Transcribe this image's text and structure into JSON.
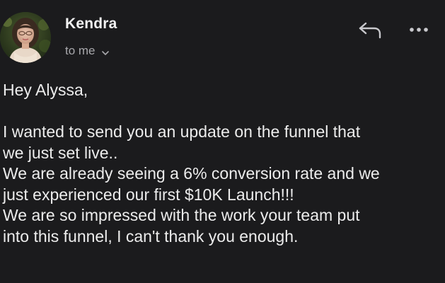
{
  "email": {
    "sender_name": "Kendra",
    "recipient_text": "to me",
    "greeting": "Hey Alyssa,",
    "body_lines": [
      "I wanted to send you an update on the funnel that",
      "we just set live..",
      "We are already seeing a 6% conversion rate and we",
      "just experienced our first $10K Launch!!!",
      "We are so impressed with the work your team put",
      "into this funnel, I can't thank you enough."
    ]
  },
  "icons": {
    "reply": "reply-icon",
    "more": "more-options-icon",
    "chevron": "chevron-down-icon",
    "avatar": "avatar"
  },
  "colors": {
    "background": "#1b1b1d",
    "text": "#ececec",
    "secondary_text": "#a8a8ac",
    "icon": "#c8c8cc"
  }
}
